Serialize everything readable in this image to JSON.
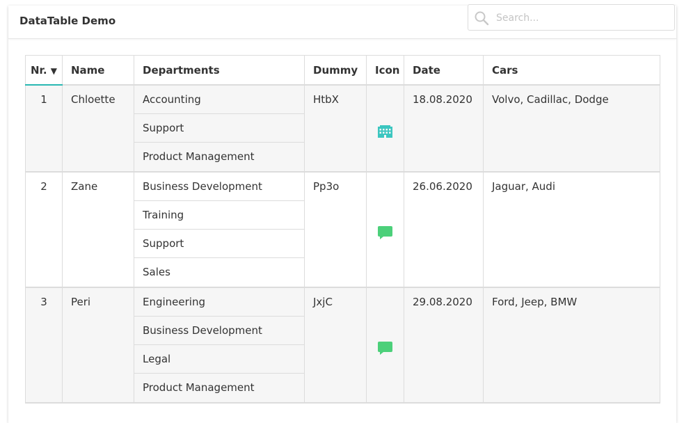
{
  "header": {
    "title": "DataTable Demo"
  },
  "search": {
    "placeholder": "Search..."
  },
  "table": {
    "columns": {
      "nr": "Nr.",
      "nr_sort": "▼",
      "name": "Name",
      "departments": "Departments",
      "dummy": "Dummy",
      "icon": "Icon",
      "date": "Date",
      "cars": "Cars"
    },
    "rows": [
      {
        "nr": "1",
        "name": "Chloette",
        "departments": [
          "Accounting",
          "Support",
          "Product Management"
        ],
        "dummy": "HtbX",
        "icon": "building-icon",
        "date": "18.08.2020",
        "cars": "Volvo, Cadillac, Dodge"
      },
      {
        "nr": "2",
        "name": "Zane",
        "departments": [
          "Business Development",
          "Training",
          "Support",
          "Sales"
        ],
        "dummy": "Pp3o",
        "icon": "comment-icon",
        "date": "26.06.2020",
        "cars": "Jaguar, Audi"
      },
      {
        "nr": "3",
        "name": "Peri",
        "departments": [
          "Engineering",
          "Business Development",
          "Legal",
          "Product Management"
        ],
        "dummy": "JxjC",
        "icon": "comment-icon",
        "date": "29.08.2020",
        "cars": "Ford, Jeep, BMW"
      }
    ]
  },
  "colors": {
    "accent": "#29b8b3",
    "icon_teal": "#3cc6c0",
    "icon_green": "#4cd07a"
  }
}
